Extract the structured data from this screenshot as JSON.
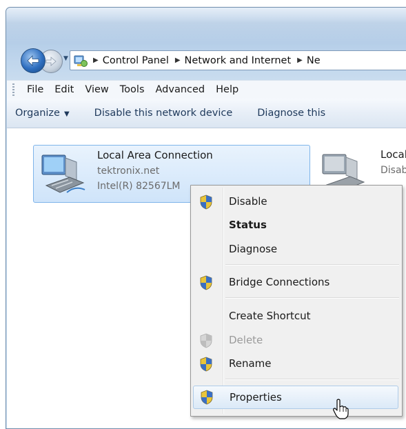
{
  "address_bar": {
    "breadcrumbs": [
      "Control Panel",
      "Network and Internet",
      "Ne"
    ]
  },
  "menu_bar": {
    "items": [
      "File",
      "Edit",
      "View",
      "Tools",
      "Advanced",
      "Help"
    ]
  },
  "command_bar": {
    "organize": "Organize",
    "disable_device": "Disable this network device",
    "diagnose": "Diagnose this"
  },
  "connections": [
    {
      "name": "Local Area Connection",
      "network": "tektronix.net",
      "adapter": "Intel(R) 82567LM",
      "selected": true
    },
    {
      "name": "Local",
      "network": "Disab"
    }
  ],
  "context_menu": {
    "items": [
      {
        "label": "Disable",
        "icon": "uac-shield-icon",
        "bold": false,
        "disabled": false
      },
      {
        "label": "Status",
        "icon": null,
        "bold": true,
        "disabled": false
      },
      {
        "label": "Diagnose",
        "icon": null,
        "bold": false,
        "disabled": false
      },
      {
        "label": "Bridge Connections",
        "icon": "uac-shield-icon",
        "bold": false,
        "disabled": false
      },
      {
        "label": "Create Shortcut",
        "icon": null,
        "bold": false,
        "disabled": false
      },
      {
        "label": "Delete",
        "icon": "uac-shield-icon",
        "bold": false,
        "disabled": true
      },
      {
        "label": "Rename",
        "icon": "uac-shield-icon",
        "bold": false,
        "disabled": false
      },
      {
        "label": "Properties",
        "icon": "uac-shield-icon",
        "bold": false,
        "disabled": false,
        "highlighted": true
      }
    ]
  },
  "colors": {
    "selection_fill": "#cfe4fa",
    "selection_border": "#7eb4ea",
    "menu_background": "#f0f0f0",
    "command_text": "#1e395b"
  }
}
